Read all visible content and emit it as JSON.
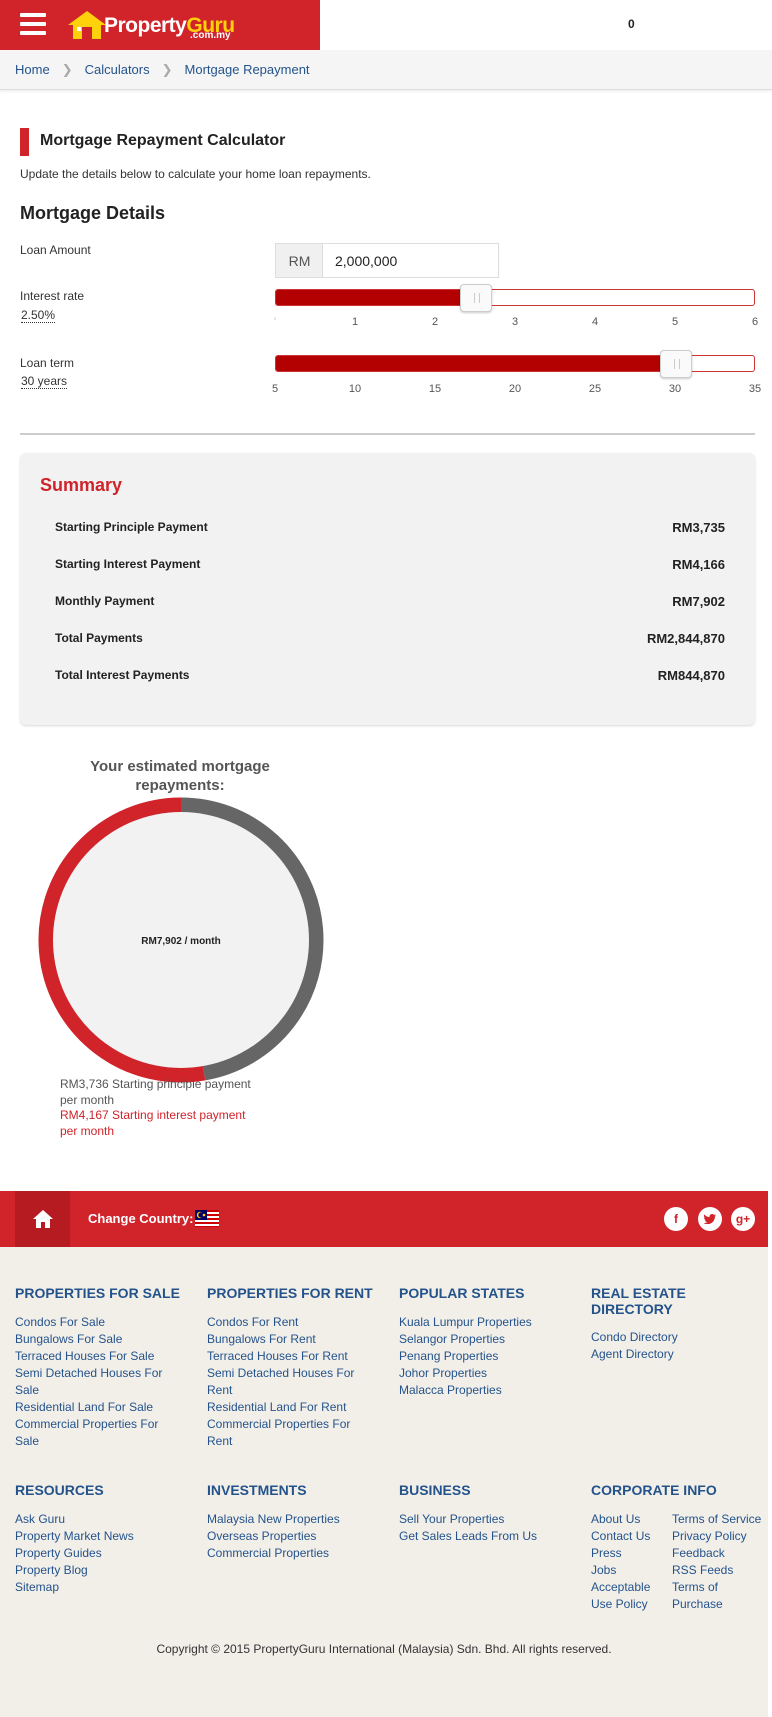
{
  "header": {
    "logo_word1": "Property",
    "logo_word2": "Guru",
    "logo_sub": ".com.my",
    "count": "0"
  },
  "breadcrumb": [
    "Home",
    "Calculators",
    "Mortgage Repayment"
  ],
  "page": {
    "title": "Mortgage Repayment Calculator",
    "description": "Update the details below to calculate your home loan repayments.",
    "section_title": "Mortgage Details"
  },
  "form": {
    "loan_amount_label": "Loan Amount",
    "currency": "RM",
    "loan_amount_value": "2,000,000",
    "interest_label": "Interest rate",
    "interest_value_text": "2.50%",
    "interest_min": 0,
    "interest_max": 6,
    "interest_value": 2.5,
    "interest_ticks": [
      "",
      "1",
      "2",
      "3",
      "4",
      "5",
      "6"
    ],
    "term_label": "Loan term",
    "term_value_text": "30 years",
    "term_min": 5,
    "term_max": 35,
    "term_value": 30,
    "term_ticks": [
      "5",
      "10",
      "15",
      "20",
      "25",
      "30",
      "35"
    ]
  },
  "summary": {
    "title": "Summary",
    "rows": [
      {
        "label": "Starting Principle Payment",
        "value": "RM3,735"
      },
      {
        "label": "Starting Interest Payment",
        "value": "RM4,166"
      },
      {
        "label": "Monthly Payment",
        "value": "RM7,902"
      },
      {
        "label": "Total Payments",
        "value": "RM2,844,870"
      },
      {
        "label": "Total Interest Payments",
        "value": "RM844,870"
      }
    ]
  },
  "chart": {
    "title": "Your estimated mortgage repayments:",
    "center_label": "RM7,902  /  month",
    "legend_principle": "RM3,736 Starting principle payment per month",
    "legend_interest": "RM4,167 Starting interest payment per month",
    "colors": {
      "principle": "#666666",
      "interest": "#d0232a"
    }
  },
  "chart_data": {
    "type": "pie",
    "categories": [
      "Starting principle payment per month",
      "Starting interest payment per month"
    ],
    "values": [
      3736,
      4167
    ]
  },
  "footer": {
    "change_country": "Change Country:",
    "columns": [
      {
        "title": "PROPERTIES FOR SALE",
        "links": [
          "Condos For Sale",
          "Bungalows For Sale",
          "Terraced Houses For Sale",
          "Semi Detached Houses For Sale",
          "Residential Land For Sale",
          "Commercial Properties For Sale"
        ]
      },
      {
        "title": "PROPERTIES FOR RENT",
        "links": [
          "Condos For Rent",
          "Bungalows For Rent",
          "Terraced Houses For Rent",
          "Semi Detached Houses For Rent",
          "Residential Land For Rent",
          "Commercial Properties For Rent"
        ]
      },
      {
        "title": "POPULAR STATES",
        "links": [
          "Kuala Lumpur Properties",
          "Selangor Properties",
          "Penang Properties",
          "Johor Properties",
          "Malacca Properties"
        ]
      },
      {
        "title": "REAL ESTATE DIRECTORY",
        "links": [
          "Condo Directory",
          "Agent Directory"
        ]
      },
      {
        "title": "RESOURCES",
        "links": [
          "Ask Guru",
          "Property Market News",
          "Property Guides",
          "Property Blog",
          "Sitemap"
        ]
      },
      {
        "title": "INVESTMENTS",
        "links": [
          "Malaysia New Properties",
          "Overseas Properties",
          "Commercial Properties"
        ]
      },
      {
        "title": "BUSINESS",
        "links": [
          "Sell Your Properties",
          "Get Sales Leads From Us"
        ]
      },
      {
        "title": "CORPORATE INFO",
        "links_a": [
          "About Us",
          "Contact Us",
          "Press",
          "Jobs",
          "Acceptable Use Policy"
        ],
        "links_b": [
          "Terms of Service",
          "Privacy Policy",
          "Feedback",
          "RSS Feeds",
          "Terms of Purchase"
        ]
      }
    ],
    "copyright": "Copyright © 2015 PropertyGuru International (Malaysia) Sdn. Bhd. All rights reserved."
  }
}
